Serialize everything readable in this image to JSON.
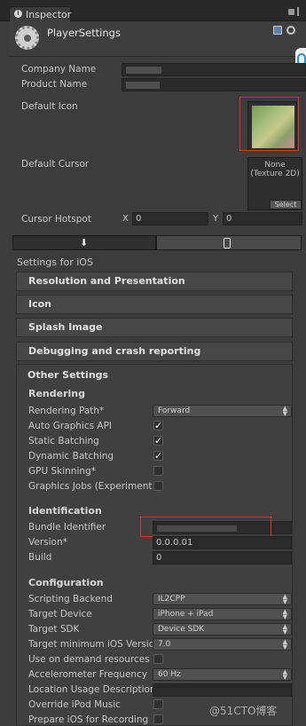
{
  "tab": {
    "title": "Inspector",
    "icon": "info-icon"
  },
  "header": {
    "title": "PlayerSettings"
  },
  "fields": {
    "company_label": "Company Name",
    "product_label": "Product Name",
    "default_icon_label": "Default Icon",
    "default_cursor_label": "Default Cursor",
    "cursor_preview": {
      "line1": "None",
      "line2": "(Texture 2D)",
      "select": "Select"
    },
    "hotspot_label": "Cursor Hotspot",
    "hotspot_x_label": "X",
    "hotspot_x": "0",
    "hotspot_y_label": "Y",
    "hotspot_y": "0"
  },
  "settings_for": "Settings for iOS",
  "sections": {
    "resolution": "Resolution and Presentation",
    "icon": "Icon",
    "splash": "Splash Image",
    "debugging": "Debugging and crash reporting",
    "other": "Other Settings"
  },
  "rendering": {
    "heading": "Rendering",
    "rows": [
      {
        "label": "Rendering Path*",
        "type": "dropdown",
        "value": "Forward"
      },
      {
        "label": "Auto Graphics API",
        "type": "checkbox",
        "checked": true
      },
      {
        "label": "Static Batching",
        "type": "checkbox",
        "checked": true
      },
      {
        "label": "Dynamic Batching",
        "type": "checkbox",
        "checked": true
      },
      {
        "label": "GPU Skinning*",
        "type": "checkbox",
        "checked": false
      },
      {
        "label": "Graphics Jobs (Experimenta",
        "type": "checkbox",
        "checked": false
      }
    ]
  },
  "identification": {
    "heading": "Identification",
    "bundle_label": "Bundle Identifier",
    "version_label": "Version*",
    "version_value": "0.0.0.01",
    "build_label": "Build",
    "build_value": "0"
  },
  "configuration": {
    "heading": "Configuration",
    "rows": [
      {
        "label": "Scripting Backend",
        "type": "dropdown",
        "value": "IL2CPP"
      },
      {
        "label": "Target Device",
        "type": "dropdown",
        "value": "iPhone + iPad"
      },
      {
        "label": "Target SDK",
        "type": "dropdown",
        "value": "Device SDK"
      },
      {
        "label": "Target minimum iOS Versio",
        "type": "dropdown",
        "value": "7.0"
      },
      {
        "label": "Use on demand resources",
        "type": "checkbox",
        "checked": false
      },
      {
        "label": "Accelerometer Frequency",
        "type": "dropdown",
        "value": "60 Hz"
      },
      {
        "label": "Location Usage Description",
        "type": "text",
        "value": ""
      },
      {
        "label": "Override iPod Music",
        "type": "checkbox",
        "checked": false
      },
      {
        "label": "Prepare iOS for Recording",
        "type": "checkbox",
        "checked": false
      }
    ]
  },
  "watermark": "@51CTO博客",
  "colors": {
    "highlight_box": "#e03030",
    "accent_blue": "#2a8fd0"
  }
}
